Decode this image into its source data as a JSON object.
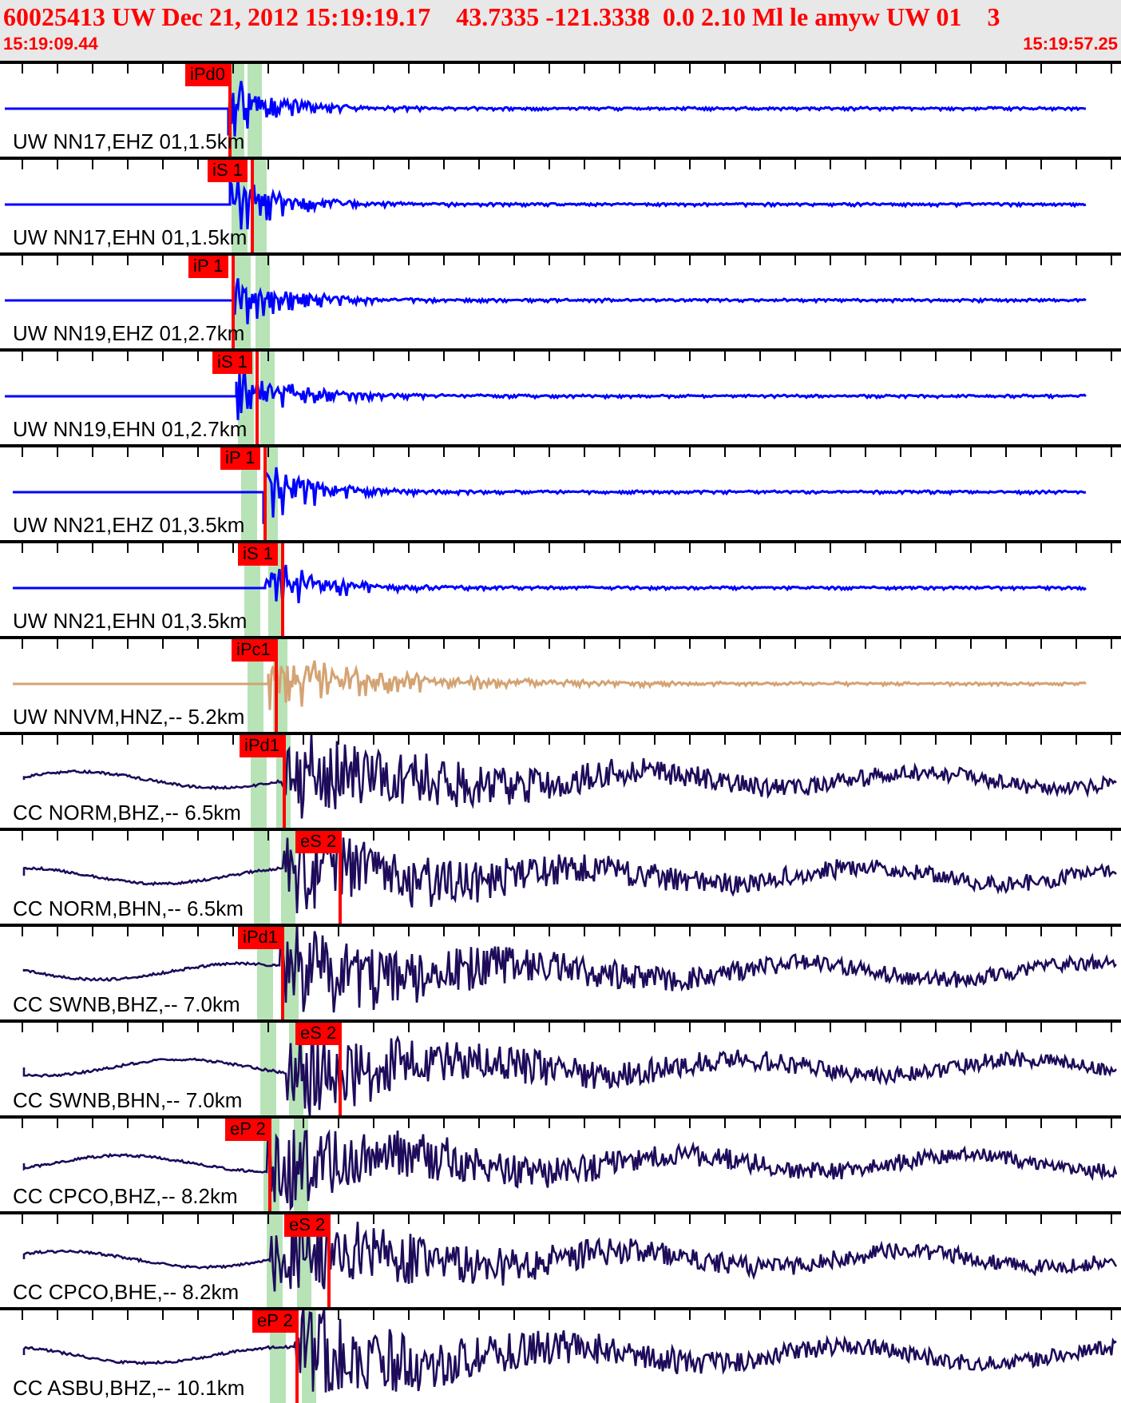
{
  "header": {
    "title": "60025413 UW Dec 21, 2012 15:19:19.17    43.7335 -121.3338  0.0 2.10 Ml le amyw UW 01    3",
    "start_time": "15:19:09.44",
    "end_time": "15:19:57.25"
  },
  "traces": [
    {
      "label": "UW NN17,EHZ 01,1.5km",
      "pick": "iPd0",
      "color": "#0000ff",
      "kind": "short"
    },
    {
      "label": "UW NN17,EHN 01,1.5km",
      "pick": "iS 1",
      "color": "#0000ff",
      "kind": "short"
    },
    {
      "label": "UW NN19,EHZ 01,2.7km",
      "pick": "iP 1",
      "color": "#0000ff",
      "kind": "short"
    },
    {
      "label": "UW NN19,EHN 01,2.7km",
      "pick": "iS 1",
      "color": "#0000ff",
      "kind": "short"
    },
    {
      "label": "UW NN21,EHZ 01,3.5km",
      "pick": "iP 1",
      "color": "#0000ff",
      "kind": "short"
    },
    {
      "label": "UW NN21,EHN 01,3.5km",
      "pick": "iS 1",
      "color": "#0000ff",
      "kind": "short"
    },
    {
      "label": "UW NNVM,HNZ,-- 5.2km",
      "pick": "iPc1",
      "color": "#d4a373",
      "kind": "short"
    },
    {
      "label": "CC NORM,BHZ,-- 6.5km",
      "pick": "iPd1",
      "color": "#1e0b5a",
      "kind": "broadband"
    },
    {
      "label": "CC NORM,BHN,-- 6.5km",
      "pick": "eS 2",
      "color": "#1e0b5a",
      "kind": "broadband"
    },
    {
      "label": "CC SWNB,BHZ,-- 7.0km",
      "pick": "iPd1",
      "color": "#1e0b5a",
      "kind": "broadband"
    },
    {
      "label": "CC SWNB,BHN,-- 7.0km",
      "pick": "eS 2",
      "color": "#1e0b5a",
      "kind": "broadband"
    },
    {
      "label": "CC CPCO,BHZ,-- 8.2km",
      "pick": "eP 2",
      "color": "#1e0b5a",
      "kind": "broadband"
    },
    {
      "label": "CC CPCO,BHE,-- 8.2km",
      "pick": "eS 2",
      "color": "#1e0b5a",
      "kind": "broadband"
    },
    {
      "label": "CC ASBU,BHZ,-- 10.1km",
      "pick": "eP 2",
      "color": "#1e0b5a",
      "kind": "broadband"
    }
  ]
}
